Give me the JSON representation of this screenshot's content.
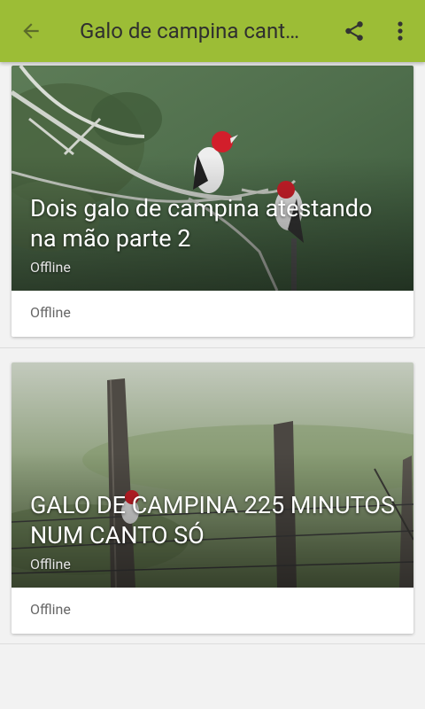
{
  "appbar": {
    "title": "Galo de campina cant…",
    "back_icon": "arrow-back-icon",
    "share_icon": "share-icon",
    "more_icon": "more-vert-icon"
  },
  "cards": [
    {
      "title": "Dois galo de campina atestando na mão parte 2",
      "overlay_status": "Offline",
      "footer_status": "Offline"
    },
    {
      "title": "GALO DE CAMPINA 225 MINUTOS NUM CANTO SÓ",
      "overlay_status": "Offline",
      "footer_status": "Offline"
    }
  ],
  "colors": {
    "appbar": "#9cbd36",
    "background": "#f2f2f2",
    "card": "#ffffff"
  }
}
